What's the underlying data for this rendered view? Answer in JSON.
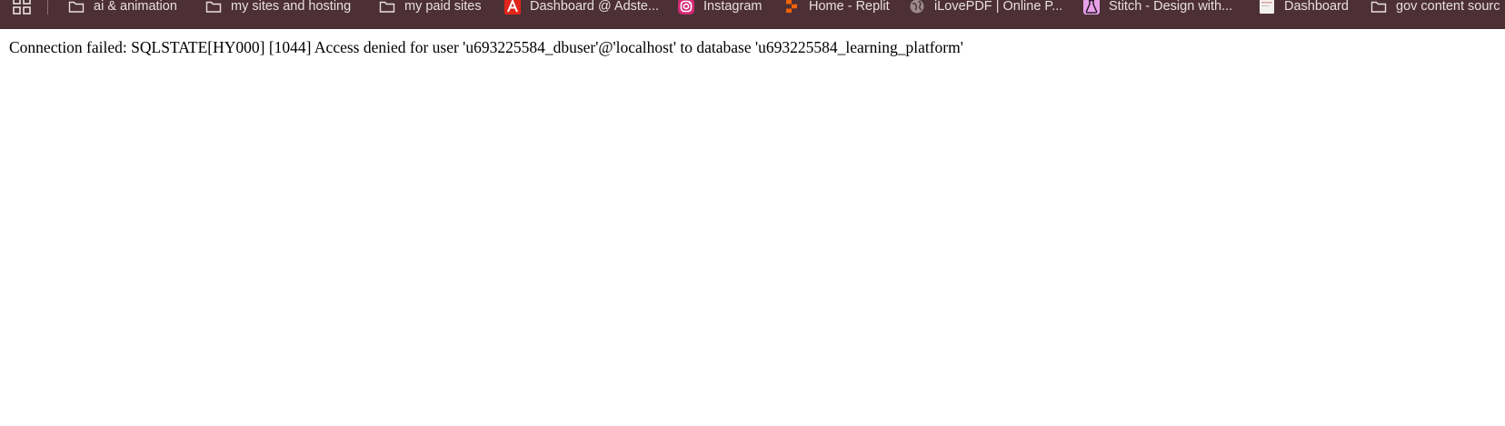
{
  "bookmarks_bar": {
    "background": "#4c3035",
    "apps_icon": "apps-grid-icon",
    "items": [
      {
        "label": "ai & animation",
        "icon": "folder-icon"
      },
      {
        "label": "my sites and hosting",
        "icon": "folder-icon"
      },
      {
        "label": "my paid sites",
        "icon": "folder-icon"
      },
      {
        "label": "Dashboard @ Adste...",
        "icon": "adsterra-icon",
        "color": "#e0251b"
      },
      {
        "label": "Instagram",
        "icon": "instagram-icon",
        "color": "#d62976"
      },
      {
        "label": "Home - Replit",
        "icon": "replit-icon",
        "color": "#f26207"
      },
      {
        "label": "iLovePDF | Online P...",
        "icon": "globe-icon"
      },
      {
        "label": "Stitch - Design with...",
        "icon": "stitch-icon",
        "color": "#e8a0e8"
      },
      {
        "label": "Dashboard",
        "icon": "dashboard-page-icon"
      },
      {
        "label": "gov content sourc",
        "icon": "folder-icon"
      }
    ]
  },
  "page": {
    "error_message": "Connection failed: SQLSTATE[HY000] [1044] Access denied for user 'u693225584_dbuser'@'localhost' to database 'u693225584_learning_platform'"
  }
}
